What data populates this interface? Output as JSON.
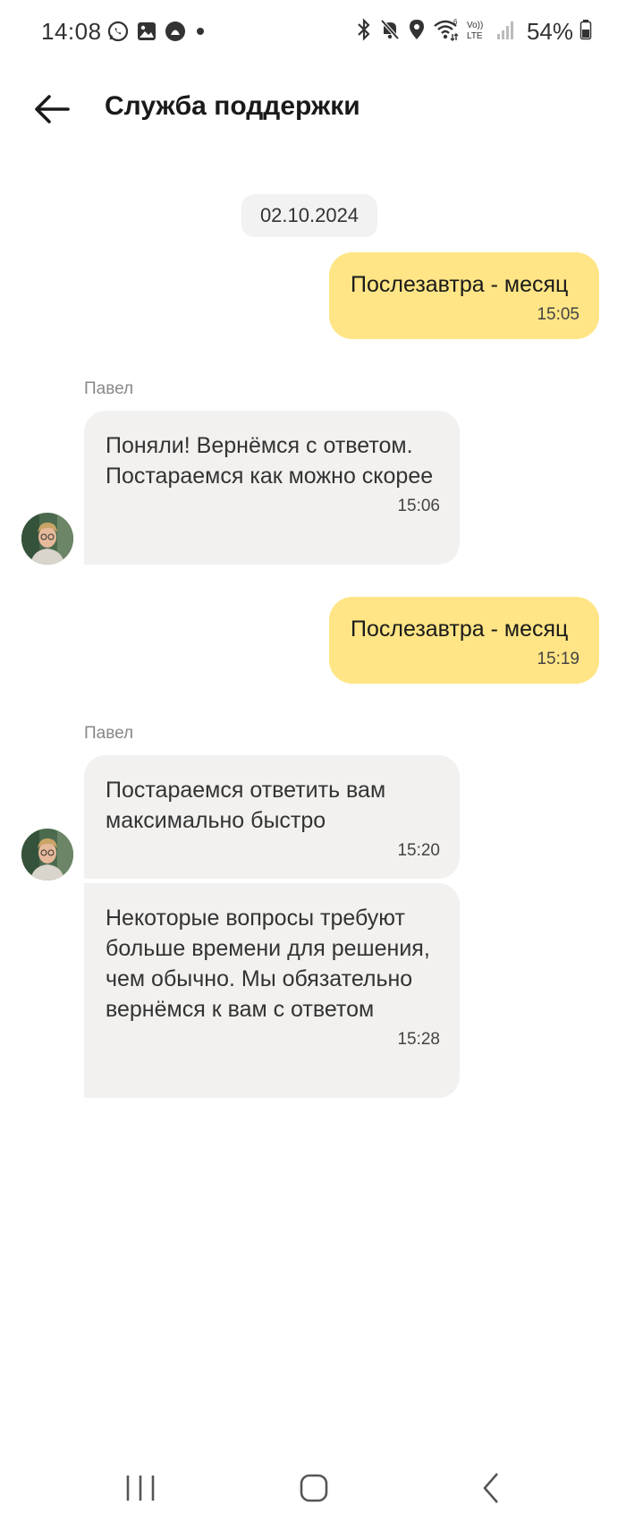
{
  "status_bar": {
    "time": "14:08",
    "battery": "54%",
    "left_icons": [
      "whatsapp-icon",
      "image-icon",
      "notification-app-icon",
      "dot-icon"
    ],
    "right_icons": [
      "bluetooth-icon",
      "mute-icon",
      "location-icon",
      "wifi-icon",
      "volte-icon",
      "signal-icon",
      "battery-icon"
    ],
    "volte_label_top": "Vo))",
    "volte_label_bottom": "LTE"
  },
  "header": {
    "title": "Служба поддержки"
  },
  "chat": {
    "date": "02.10.2024",
    "messages": [
      {
        "direction": "out",
        "text": "Послезавтра - месяц",
        "time": "15:05"
      },
      {
        "direction": "in",
        "sender": "Павел",
        "text": "Поняли! Вернёмся с ответом. Постараемся как можно скорее",
        "time": "15:06"
      },
      {
        "direction": "out",
        "text": "Послезавтра - месяц",
        "time": "15:19"
      },
      {
        "direction": "in",
        "sender": "Павел",
        "text": "Постараемся ответить вам максимально быстро",
        "time": "15:20"
      },
      {
        "direction": "in",
        "text": "Некоторые вопросы требуют больше времени для решения, чем обычно. Мы обязательно вернёмся к вам с ответом",
        "time": "15:28"
      }
    ]
  },
  "colors": {
    "outgoing_bubble": "#ffe585",
    "incoming_bubble": "#f2f1ef",
    "date_chip": "#f2f2f2"
  },
  "nav_bar": {
    "buttons": [
      "recent-apps-icon",
      "home-icon",
      "back-nav-icon"
    ]
  }
}
